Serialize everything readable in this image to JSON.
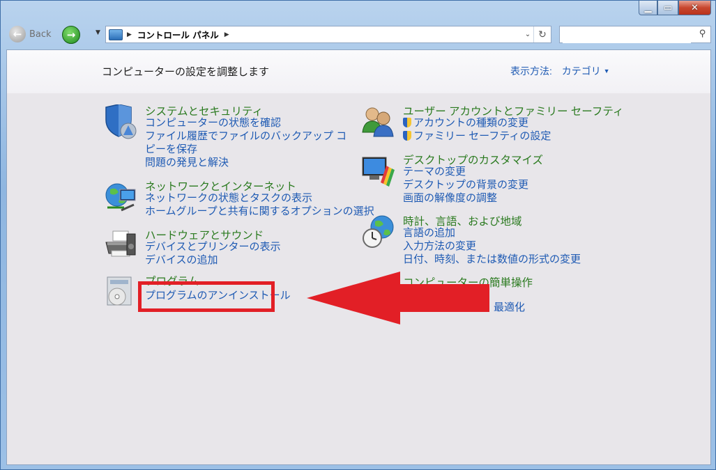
{
  "toolbar": {
    "back_label": "Back",
    "breadcrumb": "コントロール パネル",
    "search_placeholder": ""
  },
  "header": {
    "title": "コンピューターの設定を調整します",
    "view_by_label": "表示方法:",
    "view_by_value": "カテゴリ"
  },
  "categories": [
    {
      "title": "システムとセキュリティ",
      "icon": "shield-icon",
      "links": [
        "コンピューターの状態を確認",
        "ファイル履歴でファイルのバックアップ コピーを保存",
        "問題の発見と解決"
      ]
    },
    {
      "title": "ネットワークとインターネット",
      "icon": "network-globe-icon",
      "links": [
        "ネットワークの状態とタスクの表示",
        "ホームグループと共有に関するオプションの選択"
      ]
    },
    {
      "title": "ハードウェアとサウンド",
      "icon": "printer-icon",
      "links": [
        "デバイスとプリンターの表示",
        "デバイスの追加"
      ]
    },
    {
      "title": "プログラム",
      "icon": "programs-disc-icon",
      "links": [
        "プログラムのアンインストール"
      ]
    },
    {
      "title": "ユーザー アカウントとファミリー セーフティ",
      "icon": "users-icon",
      "links": [
        "アカウントの種類の変更",
        "ファミリー セーフティの設定"
      ]
    },
    {
      "title": "デスクトップのカスタマイズ",
      "icon": "desktop-monitor-icon",
      "links": [
        "テーマの変更",
        "デスクトップの背景の変更",
        "画面の解像度の調整"
      ]
    },
    {
      "title": "時計、言語、および地域",
      "icon": "clock-globe-icon",
      "links": [
        "言語の追加",
        "入力方法の変更",
        "日付、時刻、または数値の形式の変更"
      ]
    },
    {
      "title": "コンピューターの簡単操作",
      "icon": "ease-of-access-icon",
      "links": [
        "最適化"
      ]
    }
  ],
  "annotation": {
    "box_color": "#e21f26",
    "arrow_color": "#e21f26"
  }
}
